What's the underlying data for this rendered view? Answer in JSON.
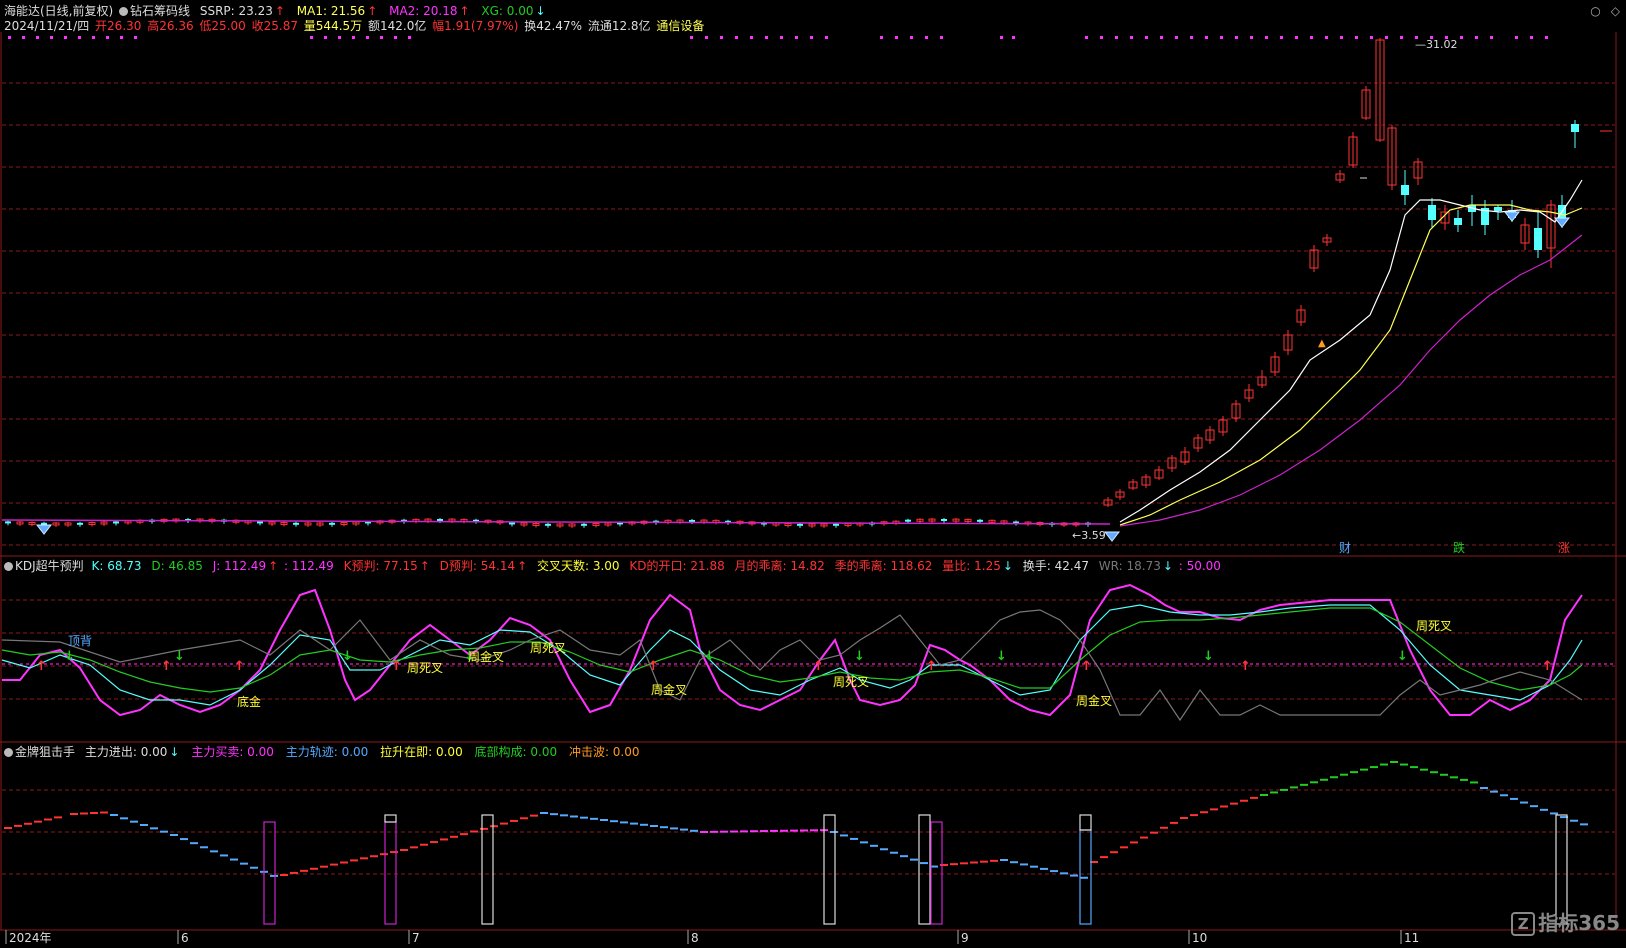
{
  "main_header": {
    "stock_name": "海能达(日线,前复权)",
    "indicator_name": "钻石筹码线",
    "ssrp": "SSRP: 23.23",
    "ma1": "MA1: 21.56",
    "ma2": "MA2: 20.18",
    "xg": "XG: 0.00"
  },
  "info_line": {
    "date": "2024/11/21/四",
    "open": "开26.30",
    "high": "高26.36",
    "low": "低25.00",
    "close": "收25.87",
    "volume": "量544.5万",
    "amount": "额142.0亿",
    "change": "幅1.91(7.97%)",
    "turnover": "换42.47%",
    "float": "流通12.8亿",
    "sector": "通信设备"
  },
  "price_labels": {
    "high_value": "31.02",
    "low_value": "3.59"
  },
  "event_markers": [
    "财",
    "跌",
    "涨"
  ],
  "kdj_header": {
    "name": "KDJ超牛预判",
    "k": "K: 68.73",
    "d": "D: 46.85",
    "j": "J: 112.49",
    "j2": ": 112.49",
    "k_pred": "K预判: 77.15",
    "d_pred": "D预判: 54.14",
    "cross_days": "交叉天数: 3.00",
    "kd_gap": "KD的开口: 21.88",
    "month_div": "月的乖离: 14.82",
    "season_div": "季的乖离: 118.62",
    "vol_ratio": "量比: 1.25",
    "turnover": "换手: 42.47",
    "wr": "WR: 18.73",
    "fifty": ": 50.00"
  },
  "kdj_labels": [
    "顶背",
    "底金",
    "周死叉",
    "周金叉",
    "周死叉",
    "周金叉",
    "周死叉",
    "周金叉",
    "周死叉"
  ],
  "bottom_header": {
    "name": "金牌狙击手",
    "main_inout": "主力进出: 0.00",
    "main_buysell": "主力买卖: 0.00",
    "main_track": "主力轨迹: 0.00",
    "pull_up": "拉升在即: 0.00",
    "bottom_form": "底部构成: 0.00",
    "shock_wave": "冲击波: 0.00"
  },
  "x_axis": [
    "2024年",
    "6",
    "7",
    "8",
    "9",
    "10",
    "11"
  ],
  "logo_text": "指标365",
  "colors": {
    "up": "#ff3333",
    "down": "#54ffff",
    "ma1": "#ffffff",
    "ma2": "#ffff55",
    "ma3": "#cc22cc",
    "magenta": "#ff33ff",
    "green": "#22cc22",
    "yellow": "#ffff33",
    "grid": "#8a1a1a"
  }
}
